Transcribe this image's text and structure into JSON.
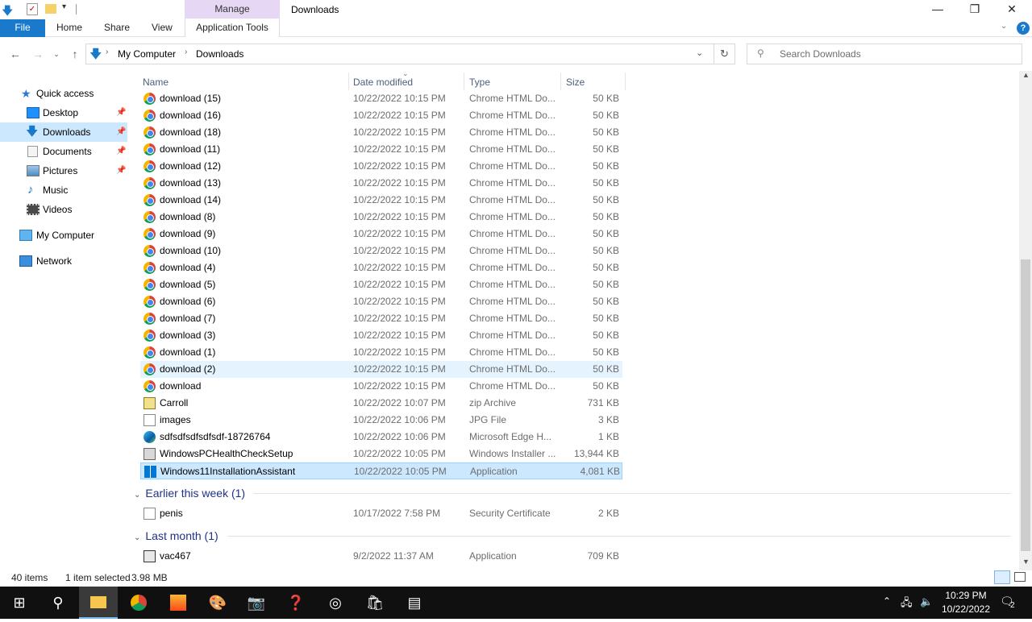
{
  "titlebar": {
    "manage_tab": "Manage",
    "title": "Downloads",
    "minimize_glyph": "—",
    "maximize_glyph": "❐",
    "close_glyph": "✕"
  },
  "ribbon": {
    "file": "File",
    "home": "Home",
    "share": "Share",
    "view": "View",
    "app_tools": "Application Tools",
    "help": "?"
  },
  "address": {
    "root": "My Computer",
    "current": "Downloads",
    "search_placeholder": "Search Downloads"
  },
  "sidebar": {
    "quick_access": "Quick access",
    "items": [
      {
        "label": "Desktop",
        "pinned": true
      },
      {
        "label": "Downloads",
        "pinned": true
      },
      {
        "label": "Documents",
        "pinned": true
      },
      {
        "label": "Pictures",
        "pinned": true
      },
      {
        "label": "Music"
      },
      {
        "label": "Videos"
      }
    ],
    "my_computer": "My Computer",
    "network": "Network"
  },
  "columns": {
    "name": "Name",
    "date": "Date modified",
    "type": "Type",
    "size": "Size"
  },
  "files": [
    {
      "name": "download (15)",
      "date": "10/22/2022 10:15 PM",
      "type": "Chrome HTML Do...",
      "size": "50 KB",
      "icon": "chrome-icon"
    },
    {
      "name": "download (16)",
      "date": "10/22/2022 10:15 PM",
      "type": "Chrome HTML Do...",
      "size": "50 KB",
      "icon": "chrome-icon"
    },
    {
      "name": "download (18)",
      "date": "10/22/2022 10:15 PM",
      "type": "Chrome HTML Do...",
      "size": "50 KB",
      "icon": "chrome-icon"
    },
    {
      "name": "download (11)",
      "date": "10/22/2022 10:15 PM",
      "type": "Chrome HTML Do...",
      "size": "50 KB",
      "icon": "chrome-icon"
    },
    {
      "name": "download (12)",
      "date": "10/22/2022 10:15 PM",
      "type": "Chrome HTML Do...",
      "size": "50 KB",
      "icon": "chrome-icon"
    },
    {
      "name": "download (13)",
      "date": "10/22/2022 10:15 PM",
      "type": "Chrome HTML Do...",
      "size": "50 KB",
      "icon": "chrome-icon"
    },
    {
      "name": "download (14)",
      "date": "10/22/2022 10:15 PM",
      "type": "Chrome HTML Do...",
      "size": "50 KB",
      "icon": "chrome-icon"
    },
    {
      "name": "download (8)",
      "date": "10/22/2022 10:15 PM",
      "type": "Chrome HTML Do...",
      "size": "50 KB",
      "icon": "chrome-icon"
    },
    {
      "name": "download (9)",
      "date": "10/22/2022 10:15 PM",
      "type": "Chrome HTML Do...",
      "size": "50 KB",
      "icon": "chrome-icon"
    },
    {
      "name": "download (10)",
      "date": "10/22/2022 10:15 PM",
      "type": "Chrome HTML Do...",
      "size": "50 KB",
      "icon": "chrome-icon"
    },
    {
      "name": "download (4)",
      "date": "10/22/2022 10:15 PM",
      "type": "Chrome HTML Do...",
      "size": "50 KB",
      "icon": "chrome-icon"
    },
    {
      "name": "download (5)",
      "date": "10/22/2022 10:15 PM",
      "type": "Chrome HTML Do...",
      "size": "50 KB",
      "icon": "chrome-icon"
    },
    {
      "name": "download (6)",
      "date": "10/22/2022 10:15 PM",
      "type": "Chrome HTML Do...",
      "size": "50 KB",
      "icon": "chrome-icon"
    },
    {
      "name": "download (7)",
      "date": "10/22/2022 10:15 PM",
      "type": "Chrome HTML Do...",
      "size": "50 KB",
      "icon": "chrome-icon"
    },
    {
      "name": "download (3)",
      "date": "10/22/2022 10:15 PM",
      "type": "Chrome HTML Do...",
      "size": "50 KB",
      "icon": "chrome-icon"
    },
    {
      "name": "download (1)",
      "date": "10/22/2022 10:15 PM",
      "type": "Chrome HTML Do...",
      "size": "50 KB",
      "icon": "chrome-icon"
    },
    {
      "name": "download (2)",
      "date": "10/22/2022 10:15 PM",
      "type": "Chrome HTML Do...",
      "size": "50 KB",
      "icon": "chrome-icon",
      "hover": true
    },
    {
      "name": "download",
      "date": "10/22/2022 10:15 PM",
      "type": "Chrome HTML Do...",
      "size": "50 KB",
      "icon": "chrome-icon"
    },
    {
      "name": "Carroll",
      "date": "10/22/2022 10:07 PM",
      "type": "zip Archive",
      "size": "731 KB",
      "icon": "zip-icon"
    },
    {
      "name": "images",
      "date": "10/22/2022 10:06 PM",
      "type": "JPG File",
      "size": "3 KB",
      "icon": "image-file-icon"
    },
    {
      "name": "sdfsdfsdfsdfsdf-18726764",
      "date": "10/22/2022 10:06 PM",
      "type": "Microsoft Edge H...",
      "size": "1 KB",
      "icon": "edge-icon"
    },
    {
      "name": "WindowsPCHealthCheckSetup",
      "date": "10/22/2022 10:05 PM",
      "type": "Windows Installer ...",
      "size": "13,944 KB",
      "icon": "installer-icon"
    },
    {
      "name": "Windows11InstallationAssistant",
      "date": "10/22/2022 10:05 PM",
      "type": "Application",
      "size": "4,081 KB",
      "icon": "windows-app-icon",
      "selected": true
    }
  ],
  "groups": [
    {
      "label": "Earlier this week (1)",
      "files": [
        {
          "name": "penis",
          "date": "10/17/2022 7:58 PM",
          "type": "Security Certificate",
          "size": "2 KB",
          "icon": "certificate-icon"
        }
      ]
    },
    {
      "label": "Last month (1)",
      "files": [
        {
          "name": "vac467",
          "date": "9/2/2022 11:37 AM",
          "type": "Application",
          "size": "709 KB",
          "icon": "app-icon"
        }
      ]
    }
  ],
  "status": {
    "count": "40 items",
    "selection": "1 item selected",
    "size": "3.98 MB"
  },
  "taskbar": {
    "time": "10:29 PM",
    "date": "10/22/2022",
    "notifications": "2"
  },
  "colors": {
    "selected_bg": "#cce8ff",
    "file_tab": "#1979ca",
    "manage_tab": "#e6d8f5",
    "group_header": "#1e3287"
  }
}
